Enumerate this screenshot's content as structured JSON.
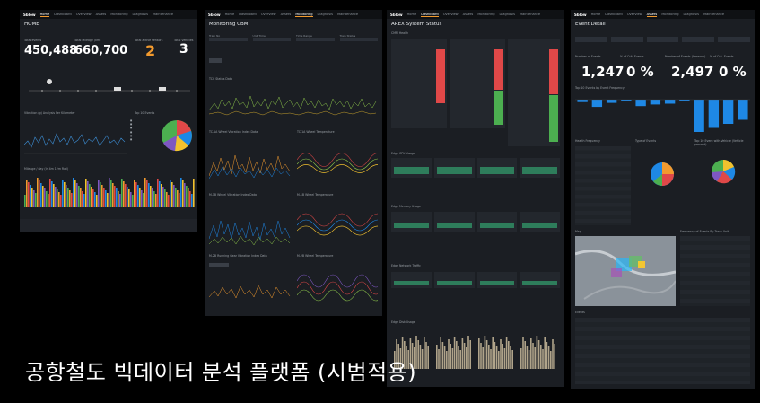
{
  "caption": "공항철도 빅데이터 분석 플랫폼 (시범적용)",
  "nav": [
    "Home",
    "Dashboard",
    "Overview",
    "Assets",
    "Monitoring",
    "Diagnosis",
    "Maintenance"
  ],
  "brand": "Sblow",
  "screens": {
    "home": {
      "title": "HOME",
      "kpis": [
        {
          "label": "Total events",
          "value": "450,488"
        },
        {
          "label": "Total Mileage (km)",
          "value": "660,700"
        },
        {
          "label": "Total active sensors",
          "value": "2"
        },
        {
          "label": "Total vehicles",
          "value": "3"
        }
      ],
      "section1": "Vibration (g) Analysis Per Kilometer",
      "section2": "Top 10 Events",
      "section3": "Mileage / day (In 4m 12m Rail)"
    },
    "monitor": {
      "title": "Monitoring CBM",
      "filters": [
        "Train No",
        "Unit Time",
        "Time Range",
        "Train Status"
      ],
      "section1": "TCC Status Data",
      "section2a": "TC-1A Wheel Vibration Index Data",
      "section2b": "TC-1A Wheel Temperature",
      "section3a": "M-1B Wheel Vibration Index Data",
      "section3b": "M-1B Wheel Temperature",
      "section4a": "M-2B Running Gear Vibration Index Data",
      "section4b": "M-2B Wheel Temperature"
    },
    "status": {
      "title": "AREX System Status",
      "subtitle": "CMM Health",
      "section1": "Edge CPU Usage",
      "section2": "Edge Memory Usage",
      "section3": "Edge Network Traffic",
      "section4": "Edge Disk Usage"
    },
    "event": {
      "title": "Event Detail",
      "kpis": [
        {
          "label": "Number of Events",
          "value": "1,247"
        },
        {
          "label": "% of Crit. Events",
          "value": "0 %"
        },
        {
          "label": "Number of Events (Seasons)",
          "value": "2,497"
        },
        {
          "label": "% of Crit. Events",
          "value": "0 %"
        }
      ],
      "section1": "Top 10 Events by Event Frequency",
      "section2": "Health Frequency",
      "section3": "Type of Events",
      "section4": "Top 10 Event with Vehicle (Vehicle percent)",
      "section5": "Map",
      "section6": "Frequency of Events By Track Unit",
      "section7": "Events"
    }
  },
  "colors": {
    "accent": "#f29a2e",
    "green": "#4caf50",
    "red": "#e04848",
    "blue": "#1e88e5",
    "panel": "#1b1e23"
  },
  "chart_data": [
    {
      "type": "pie",
      "title": "Top 10 Events",
      "values": [
        30,
        20,
        18,
        12,
        10,
        10
      ]
    },
    {
      "type": "bar",
      "title": "Top 10 Events by Event Frequency",
      "values": [
        3,
        9,
        4,
        2,
        8,
        6,
        5,
        2,
        40,
        35,
        30,
        25
      ]
    }
  ]
}
